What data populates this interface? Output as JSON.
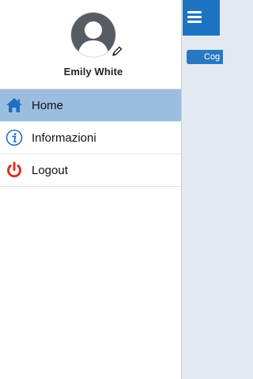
{
  "user": {
    "name": "Emily White"
  },
  "menu": {
    "items": [
      {
        "label": "Home",
        "icon": "home-icon",
        "active": true
      },
      {
        "label": "Informazioni",
        "icon": "info-icon",
        "active": false
      },
      {
        "label": "Logout",
        "icon": "power-icon",
        "active": false
      }
    ]
  },
  "topbar": {
    "menu_icon": "hamburger-icon"
  },
  "content": {
    "button_label": "Cog"
  },
  "colors": {
    "topbar": "#1e73c0",
    "active_item": "#9bbde0",
    "home_icon": "#1e6fbf",
    "info_icon": "#1f6fc3",
    "logout_icon": "#d93025",
    "background": "#e3e9f1"
  }
}
